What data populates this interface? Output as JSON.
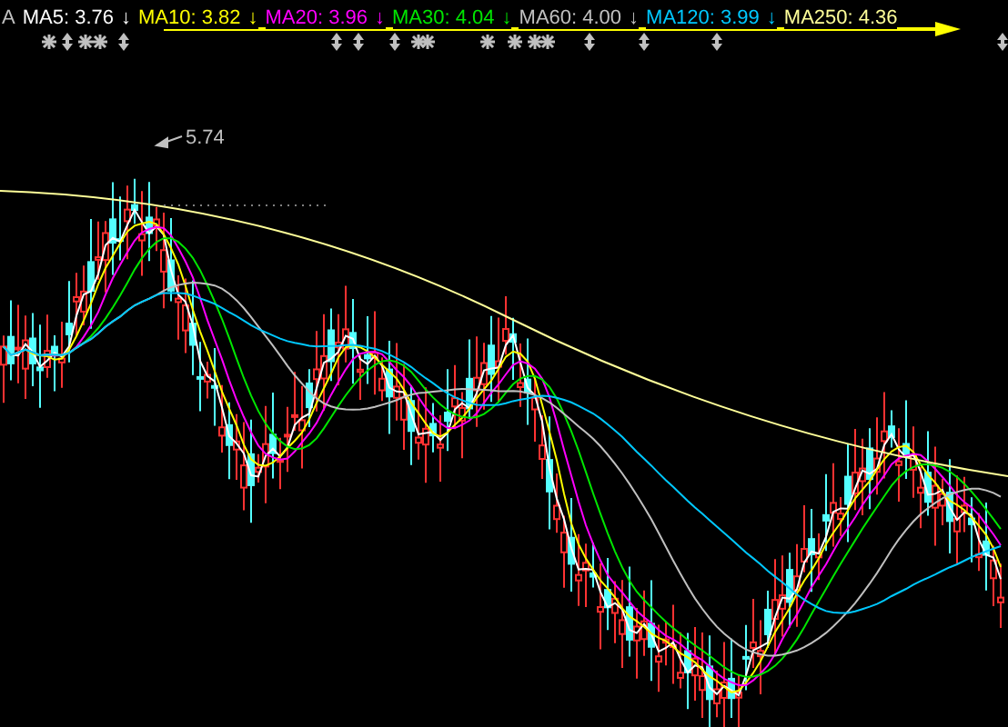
{
  "legend": {
    "cut_label": "A",
    "items": [
      {
        "label": "MA5: 3.76",
        "arrow": "↓",
        "color": "#ffffff"
      },
      {
        "label": "MA10: 3.82",
        "arrow": "↓",
        "color": "#ffff00"
      },
      {
        "label": "MA20: 3.96",
        "arrow": "↓",
        "color": "#ff00ff"
      },
      {
        "label": "MA30: 4.04",
        "arrow": "↓",
        "color": "#00e600"
      },
      {
        "label": "MA60: 4.00",
        "arrow": "↓",
        "color": "#c0c0c0"
      },
      {
        "label": "MA120: 3.99",
        "arrow": "↓",
        "color": "#00c8ff"
      },
      {
        "label": "MA250: 4.36",
        "color": "#ffff99"
      }
    ]
  },
  "chart": {
    "peak_label": "5.74"
  }
}
